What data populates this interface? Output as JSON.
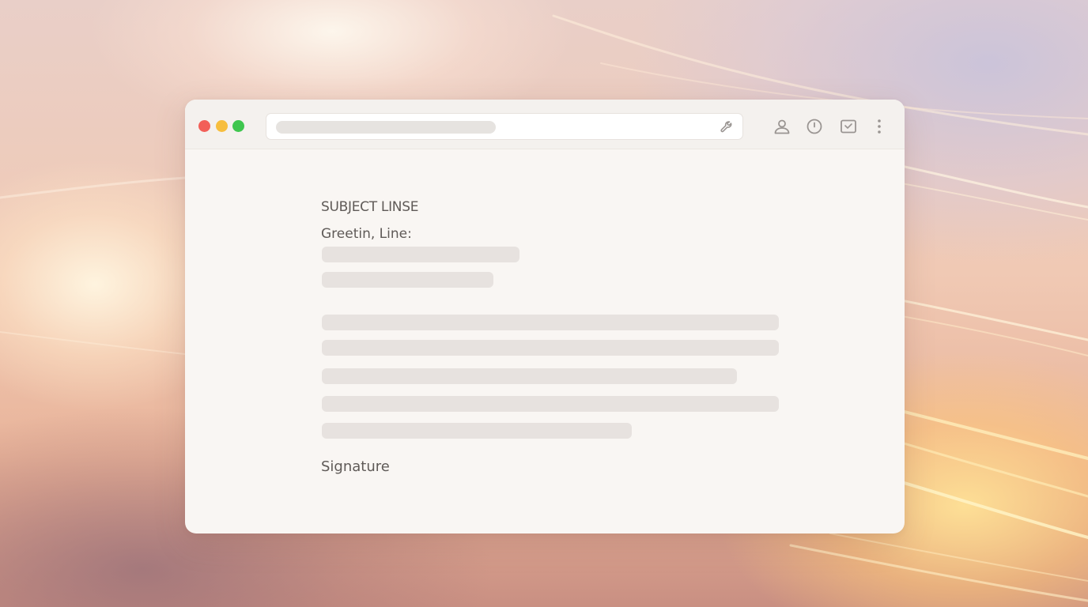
{
  "window": {
    "url_value": "",
    "menu_icons": [
      "user-icon",
      "clock-icon",
      "inbox-icon",
      "more-vertical-icon"
    ],
    "address_icon": "wrench-icon"
  },
  "email": {
    "subject": "SUBJECT LINSE",
    "greeting": "Greetin, Line:",
    "signature": "Signature"
  },
  "colors": {
    "traffic_red": "#f25f58",
    "traffic_yellow": "#f7be3e",
    "traffic_green": "#3fc64f",
    "text": "#5f5a57",
    "placeholder": "#e7e2df"
  }
}
